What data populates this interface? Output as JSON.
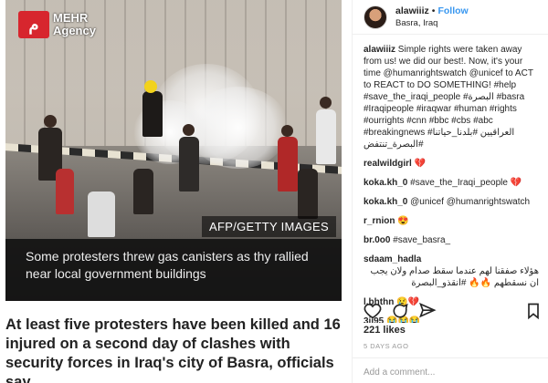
{
  "news": {
    "logo_mark": "ﻡ",
    "logo_line1": "MEHR",
    "logo_line2": "Agency",
    "photo_credit": "AFP/GETTY IMAGES",
    "caption": "Some protesters threw gas canisters as thy rallied near local government buildings",
    "headline": "At least five protesters have been killed and 16 injured on a second day of clashes with security forces in Iraq's city of Basra, officials say."
  },
  "post": {
    "username": "alawiiiz",
    "follow_label": "Follow",
    "location": "Basra, Iraq",
    "caption_user": "alawiiiz",
    "caption_text": "Simple rights were taken away from us! we did our best!. Now, it's your time @humanrightswatch @unicef to ACT to REACT to DO SOMETHING! #help #save_the_iraqi_people #البصرة #basra #Iraqipeople #iraqwar #human #rights #ourrights #cnn #bbc #cbs #abc #breakingnews #العراقيين #بلدنا_حياتنا #البصرة_تنتفض",
    "comments": [
      {
        "user": "realwildgirl",
        "text": "💔"
      },
      {
        "user": "koka.kh_0",
        "text": "#save_the_Iraqi_people 💔"
      },
      {
        "user": "koka.kh_0",
        "text": "@unicef @humanrightswatch"
      },
      {
        "user": "r_rnion",
        "text": "😍"
      },
      {
        "user": "br.0o0",
        "text": "#save_basra_"
      },
      {
        "user": "sdaam_hadla",
        "text": "هؤلاء صفقنا لهم عندما سقط صدام ولان يجب ان نسقطهم 🔥🔥 #انقذو_البصرة"
      },
      {
        "user": "l.bhthn",
        "text": "😢💔"
      },
      {
        "user": "3ii95",
        "text": "😭😭😭"
      }
    ],
    "likes": "221 likes",
    "time_ago": "5 DAYS AGO",
    "add_comment_placeholder": "Add a comment..."
  },
  "colors": {
    "accent": "#3897f0",
    "mehr_red": "#d7262e",
    "link": "#003569"
  }
}
